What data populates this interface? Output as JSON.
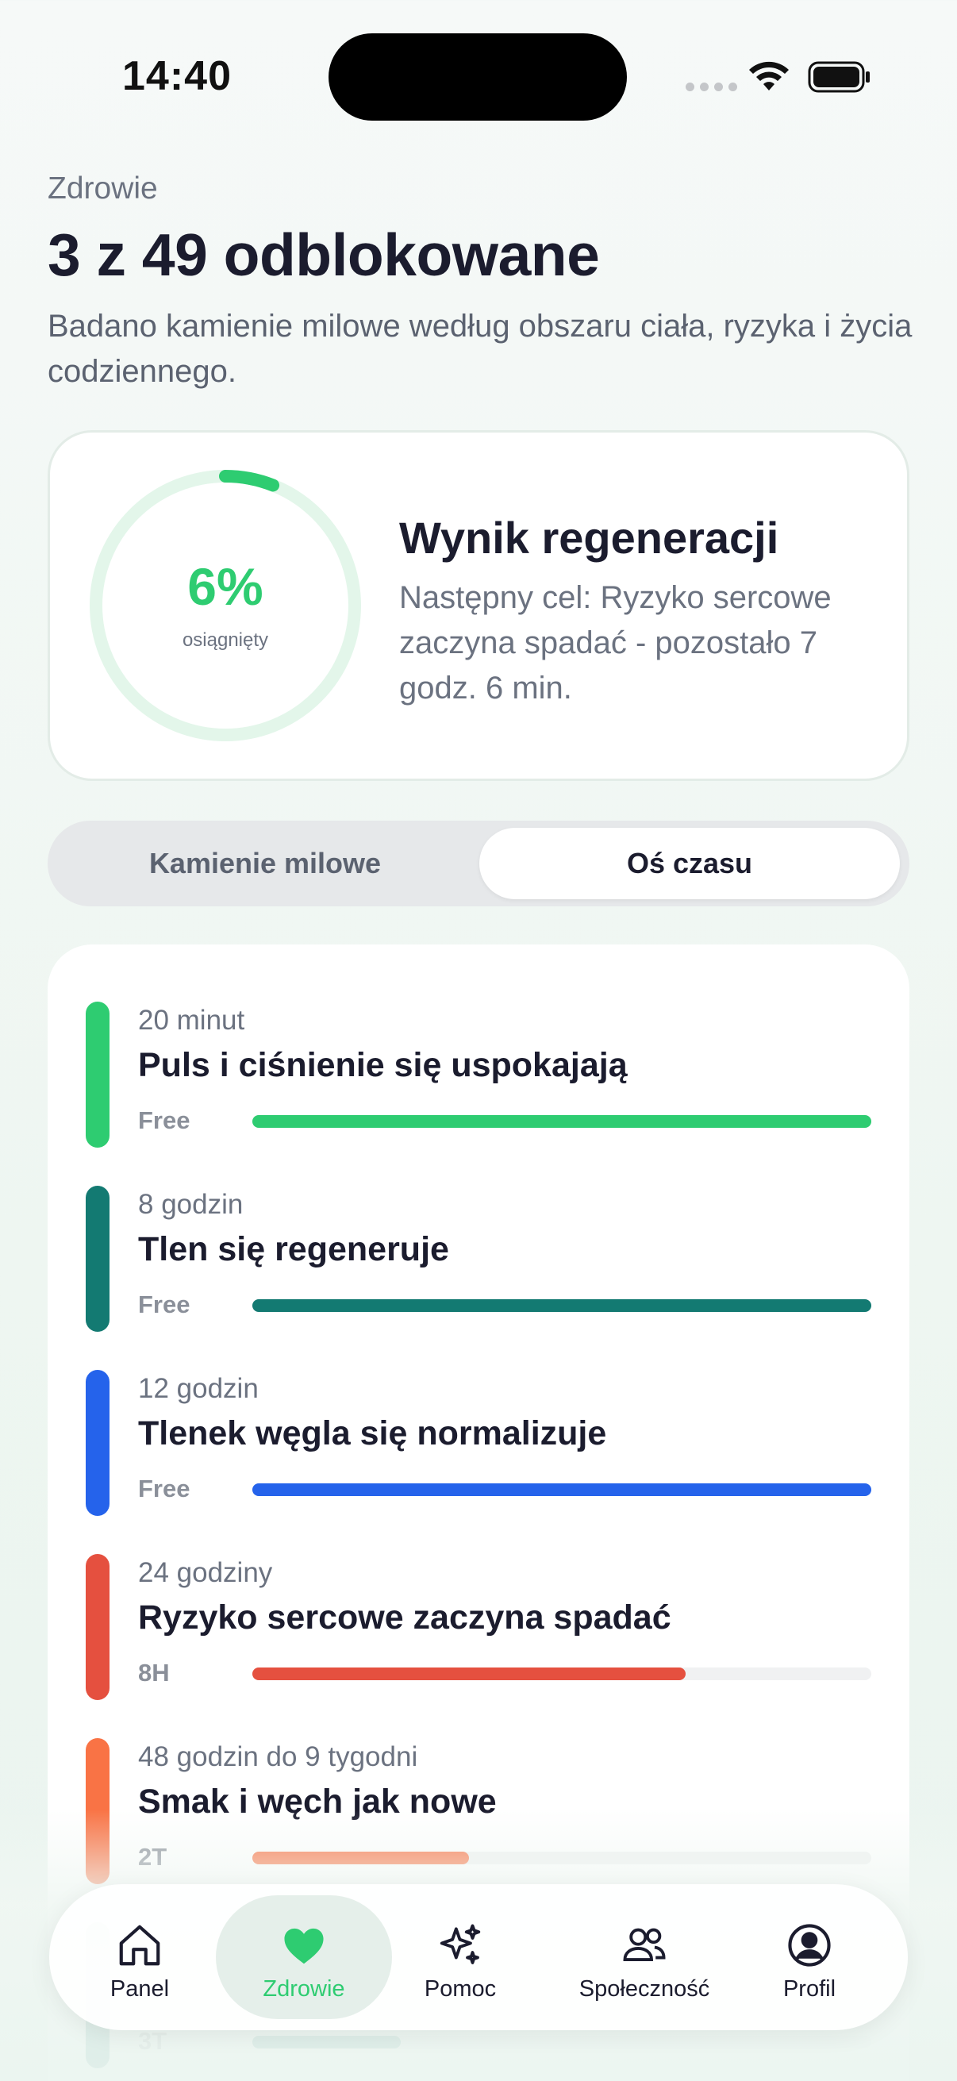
{
  "status_bar": {
    "time": "14:40"
  },
  "header": {
    "section": "Zdrowie",
    "title": "3 z 49 odblokowane",
    "description": "Badano kamienie milowe według obszaru ciała, ryzyka i życia codziennego."
  },
  "score": {
    "percent_label": "6%",
    "percent_value": 0.06,
    "sub_label": "osiągnięty",
    "title": "Wynik regeneracji",
    "description": "Następny cel: Ryzyko sercowe zaczyna spadać - pozostało 7 godz. 6 min.",
    "accent_color": "#2ecc71"
  },
  "segment": {
    "left_label": "Kamienie milowe",
    "right_label": "Oś czasu",
    "selected": "Oś czasu"
  },
  "timeline": {
    "items": [
      {
        "time": "20 minut",
        "title": "Puls i ciśnienie się uspokajają",
        "tag": "Free",
        "color": "#2ecc71",
        "progress": 1.0
      },
      {
        "time": "8 godzin",
        "title": "Tlen się regeneruje",
        "tag": "Free",
        "color": "#137a72",
        "progress": 1.0
      },
      {
        "time": "12 godzin",
        "title": "Tlenek węgla się normalizuje",
        "tag": "Free",
        "color": "#2563eb",
        "progress": 1.0
      },
      {
        "time": "24 godziny",
        "title": "Ryzyko sercowe zaczyna spadać",
        "tag": "8H",
        "color": "#e5503f",
        "progress": 0.7
      },
      {
        "time": "48 godzin do 9 tygodni",
        "title": "Smak i węch jak nowe",
        "tag": "2T",
        "color": "#f97345",
        "progress": 0.35
      },
      {
        "time": "",
        "title": "",
        "tag": "3T",
        "color": "#137a72",
        "progress": 0.24
      }
    ]
  },
  "tabbar": {
    "tabs": [
      {
        "label": "Panel",
        "icon": "home-icon"
      },
      {
        "label": "Zdrowie",
        "icon": "heart-icon",
        "active": true
      },
      {
        "label": "Pomoc",
        "icon": "sparkles-icon"
      },
      {
        "label": "Społeczność",
        "icon": "people-icon"
      },
      {
        "label": "Profil",
        "icon": "profile-icon"
      }
    ]
  }
}
